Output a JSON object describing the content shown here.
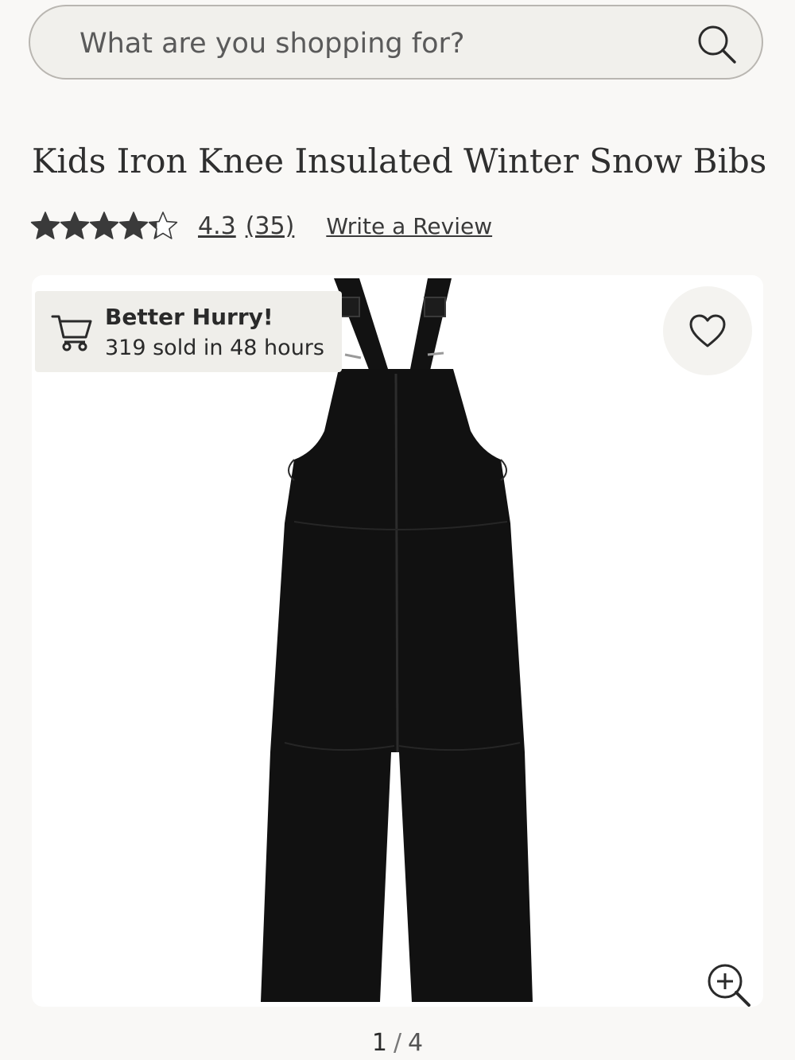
{
  "search": {
    "placeholder": "What are you shopping for?",
    "icon": "search-icon"
  },
  "product": {
    "title": "Kids Iron Knee Insulated Winter Snow Bibs",
    "rating": {
      "value": 4.3,
      "value_label": "4.3",
      "max": 5,
      "count_label": "(35)"
    },
    "write_review_label": "Write a Review"
  },
  "badge": {
    "title": "Better Hurry!",
    "subtitle": "319 sold in 48 hours",
    "icon": "cart-icon"
  },
  "gallery": {
    "current_page": "1",
    "separator": "/",
    "total_pages": "4",
    "favorite_icon": "heart-icon",
    "zoom_icon": "zoom-in-icon"
  },
  "colors": {
    "background": "#f9f8f6",
    "star": "#3a3a3a",
    "product": "#111111"
  }
}
